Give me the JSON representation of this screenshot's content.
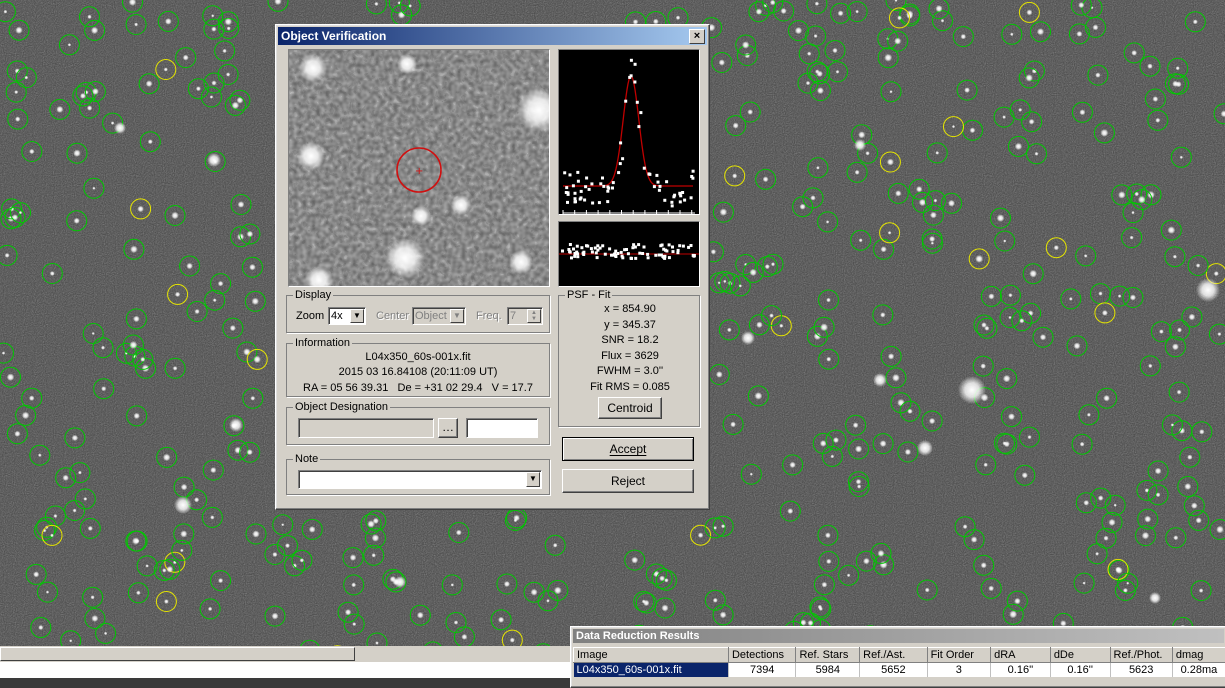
{
  "dialog": {
    "title": "Object Verification",
    "close_glyph": "×",
    "display": {
      "legend": "Display",
      "zoom_label": "Zoom",
      "zoom_value": "4x",
      "center_label": "Center",
      "center_value": "Object",
      "freq_label": "Freq.",
      "freq_value": "7"
    },
    "information": {
      "legend": "Information",
      "filename": "L04x350_60s-001x.fit",
      "datetime": "2015 03 16.84108 (20:11:09 UT)",
      "coords": "RA = 05 56 39.31   De = +31 02 29.4   V = 17.7"
    },
    "designation": {
      "legend": "Object Designation",
      "browse_glyph": "…"
    },
    "note": {
      "legend": "Note"
    },
    "psf": {
      "legend": "PSF - Fit",
      "x": "x = 854.90",
      "y": "y = 345.37",
      "snr": "SNR = 18.2",
      "flux": "Flux = 3629",
      "fwhm": "FWHM = 3.0''",
      "fit_rms": "Fit RMS = 0.085",
      "centroid_label": "Centroid"
    },
    "accept_label": "Accept",
    "reject_label": "Reject"
  },
  "results": {
    "title": "Data Reduction Results",
    "columns": [
      "Image",
      "Detections",
      "Ref. Stars",
      "Ref./Ast.",
      "Fit Order",
      "dRA",
      "dDe",
      "Ref./Phot.",
      "dmag"
    ],
    "row": [
      "L04x350_60s-001x.fit",
      "7394",
      "5984",
      "5652",
      "3",
      "0.16''",
      "0.16''",
      "5623",
      "0.28ma"
    ]
  },
  "colors": {
    "titlebar": "#0a246a",
    "marker_green": "#00c800",
    "marker_yellow": "#e6e600",
    "target_circle": "#d01010",
    "fit_curve": "#c00000"
  }
}
